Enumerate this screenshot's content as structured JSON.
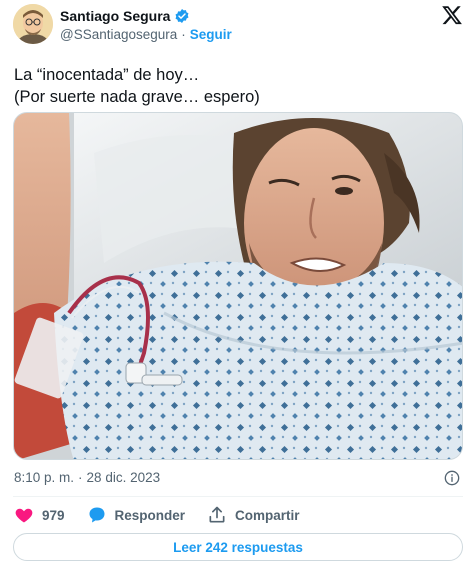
{
  "author": {
    "display_name": "Santiago Segura",
    "handle": "@SSantiagosegura",
    "separator": "·",
    "follow_label": "Seguir"
  },
  "tweet": {
    "text_line_1": "La “inocentada” de hoy…",
    "text_line_2": "(Por suerte nada grave… espero)"
  },
  "meta": {
    "time": "8:10 p. m.",
    "separator": "·",
    "date": "28 dic. 2023"
  },
  "actions": {
    "like_count": "979",
    "reply_label": "Responder",
    "share_label": "Compartir"
  },
  "replies_button": {
    "label": "Leer 242 respuestas"
  },
  "icons": {
    "verified": "verified-badge-icon",
    "x_logo": "x-logo-icon",
    "info": "info-icon",
    "like": "heart-icon",
    "reply": "speech-bubble-icon",
    "share": "share-upload-icon"
  },
  "colors": {
    "accent": "#1d9bf0",
    "like": "#f91880",
    "text": "#0f1419",
    "secondary": "#536471"
  }
}
